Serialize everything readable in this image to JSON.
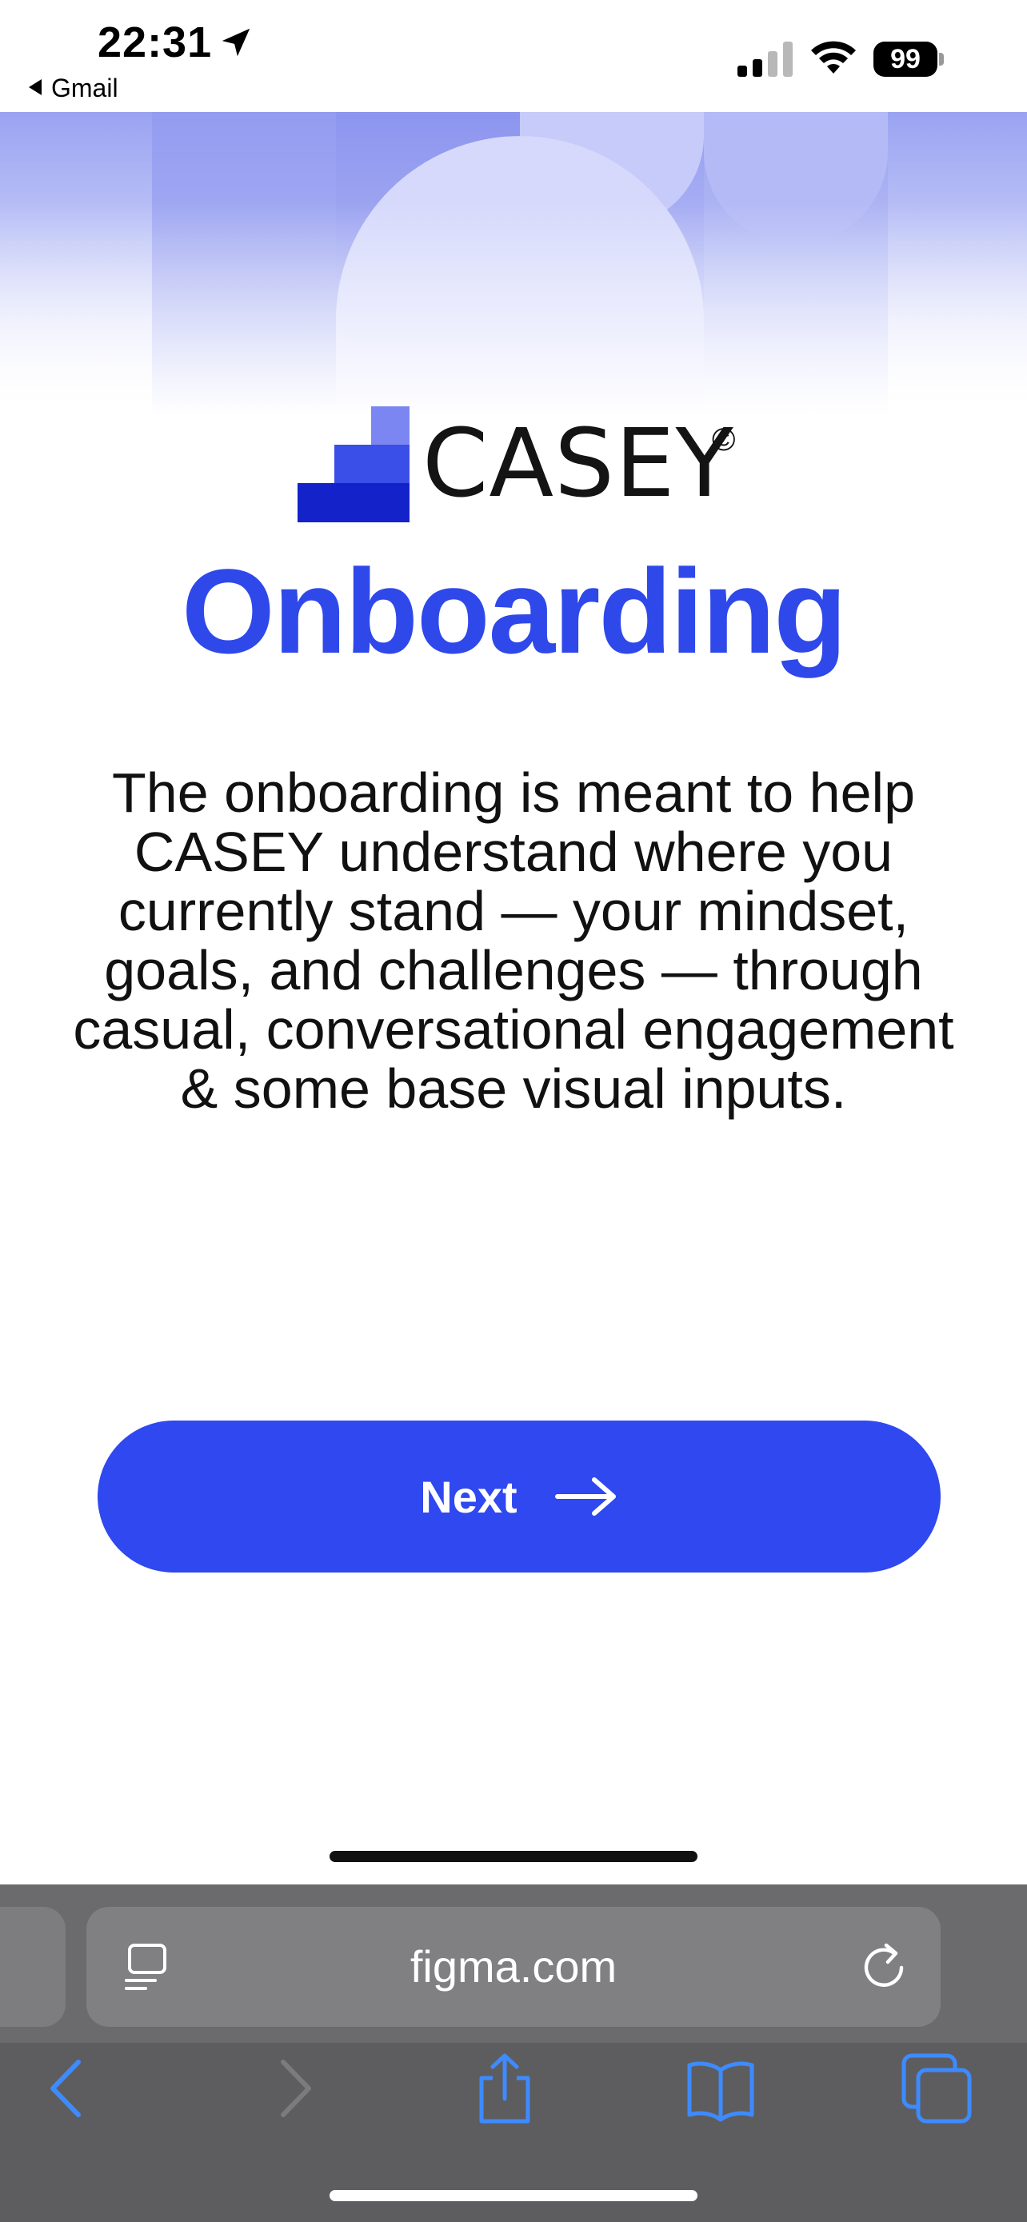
{
  "status_bar": {
    "time": "22:31",
    "back_app": "Gmail",
    "battery": "99"
  },
  "logo": {
    "text": "CASEY",
    "mark": "©"
  },
  "page": {
    "title": "Onboarding",
    "description": "The onboarding is meant to help CASEY understand where you currently stand — your mindset, goals, and challenges — through casual, conversational engagement & some base visual inputs."
  },
  "next_button": {
    "label": "Next",
    "icon": "arrow-right-icon"
  },
  "browser": {
    "url": "figma.com",
    "toolbar": [
      "back-icon",
      "forward-icon",
      "share-icon",
      "bookmarks-icon",
      "tabs-icon"
    ]
  },
  "colors": {
    "accent": "#2f48f0",
    "title": "#2f48ea",
    "safari_blue": "#3d8bff"
  }
}
